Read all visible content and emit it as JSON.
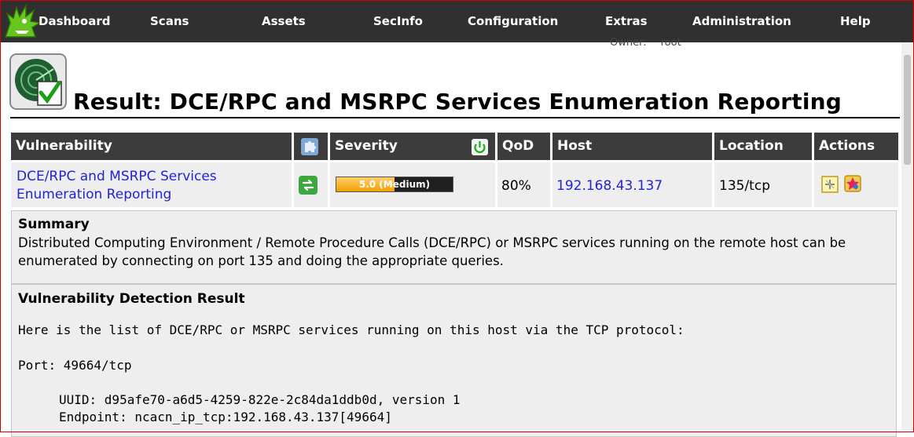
{
  "nav": {
    "items": [
      "Dashboard",
      "Scans",
      "Assets",
      "SecInfo",
      "Configuration",
      "Extras",
      "Administration",
      "Help"
    ]
  },
  "owner": {
    "label": "Owner:",
    "value": "root"
  },
  "page": {
    "title": "Result: DCE/RPC and MSRPC Services Enumeration Reporting"
  },
  "table": {
    "headers": {
      "vulnerability": "Vulnerability",
      "severity": "Severity",
      "qod": "QoD",
      "host": "Host",
      "location": "Location",
      "actions": "Actions"
    },
    "row": {
      "vulnerability_line1": "DCE/RPC and MSRPC Services",
      "vulnerability_line2": "Enumeration Reporting",
      "severity_text": "5.0 (Medium)",
      "severity_value": 5.0,
      "severity_max": 10,
      "qod": "80%",
      "host": "192.168.43.137",
      "location": "135/tcp"
    }
  },
  "summary": {
    "heading": "Summary",
    "text": "Distributed Computing Environment / Remote Procedure Calls (DCE/RPC) or MSRPC services running on the remote host can be enumerated by connecting on port 135 and doing the appropriate queries."
  },
  "detection": {
    "heading": "Vulnerability Detection Result",
    "line1": "Here is the list of DCE/RPC or MSRPC services running on this host via the TCP protocol:",
    "line2": "Port: 49664/tcp",
    "line3": "UUID: d95afe70-a6d5-4259-822e-2c84da1ddb0d, version 1",
    "line4": "Endpoint: ncacn_ip_tcp:192.168.43.137[49664]"
  },
  "colors": {
    "navbar": "#303030",
    "header": "#3c3c3c",
    "link": "#2323d6",
    "severity_medium": "#f0a000"
  }
}
